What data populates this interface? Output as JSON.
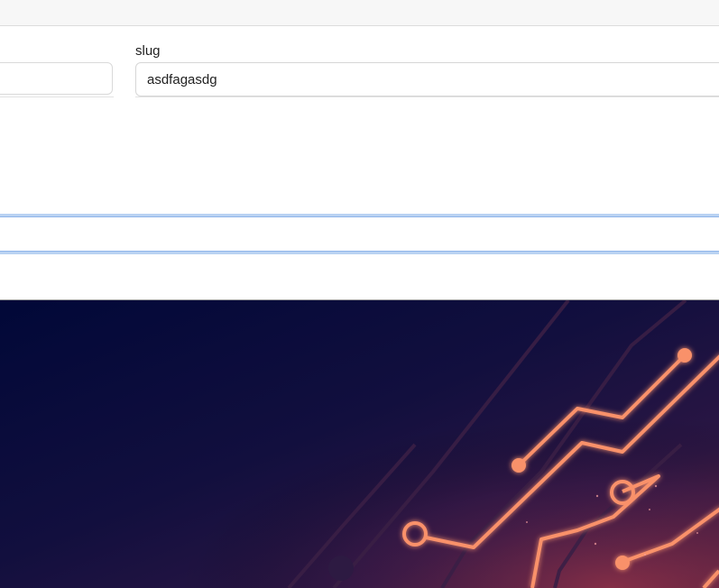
{
  "form": {
    "slug": {
      "label": "slug",
      "value": "asdfagasdg"
    }
  },
  "hero": {
    "image": "circuit-board-illustration",
    "colors": {
      "background_dark": "#020a35",
      "background_purple": "#2a1440",
      "trace": "#f9916a",
      "trace_dim": "#4a2745"
    }
  }
}
